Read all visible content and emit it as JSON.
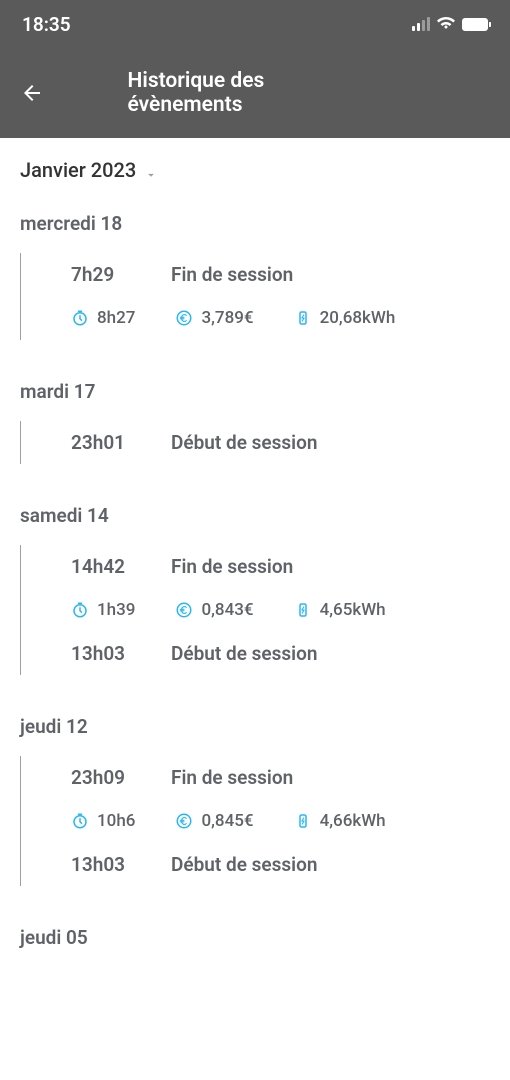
{
  "status": {
    "time": "18:35"
  },
  "header": {
    "title": "Historique des évènements"
  },
  "month": "Janvier 2023",
  "days": [
    {
      "label": "mercredi 18",
      "events": [
        {
          "time": "7h29",
          "label": "Fin de session",
          "metrics": {
            "duration": "8h27",
            "cost": "3,789€",
            "energy": "20,68kWh"
          }
        }
      ]
    },
    {
      "label": "mardi 17",
      "events": [
        {
          "time": "23h01",
          "label": "Début de session"
        }
      ]
    },
    {
      "label": "samedi 14",
      "events": [
        {
          "time": "14h42",
          "label": "Fin de session",
          "metrics": {
            "duration": "1h39",
            "cost": "0,843€",
            "energy": "4,65kWh"
          }
        },
        {
          "time": "13h03",
          "label": "Début de session"
        }
      ]
    },
    {
      "label": "jeudi 12",
      "events": [
        {
          "time": "23h09",
          "label": "Fin de session",
          "metrics": {
            "duration": "10h6",
            "cost": "0,845€",
            "energy": "4,66kWh"
          }
        },
        {
          "time": "13h03",
          "label": "Début de session"
        }
      ]
    },
    {
      "label": "jeudi 05",
      "events": []
    }
  ]
}
